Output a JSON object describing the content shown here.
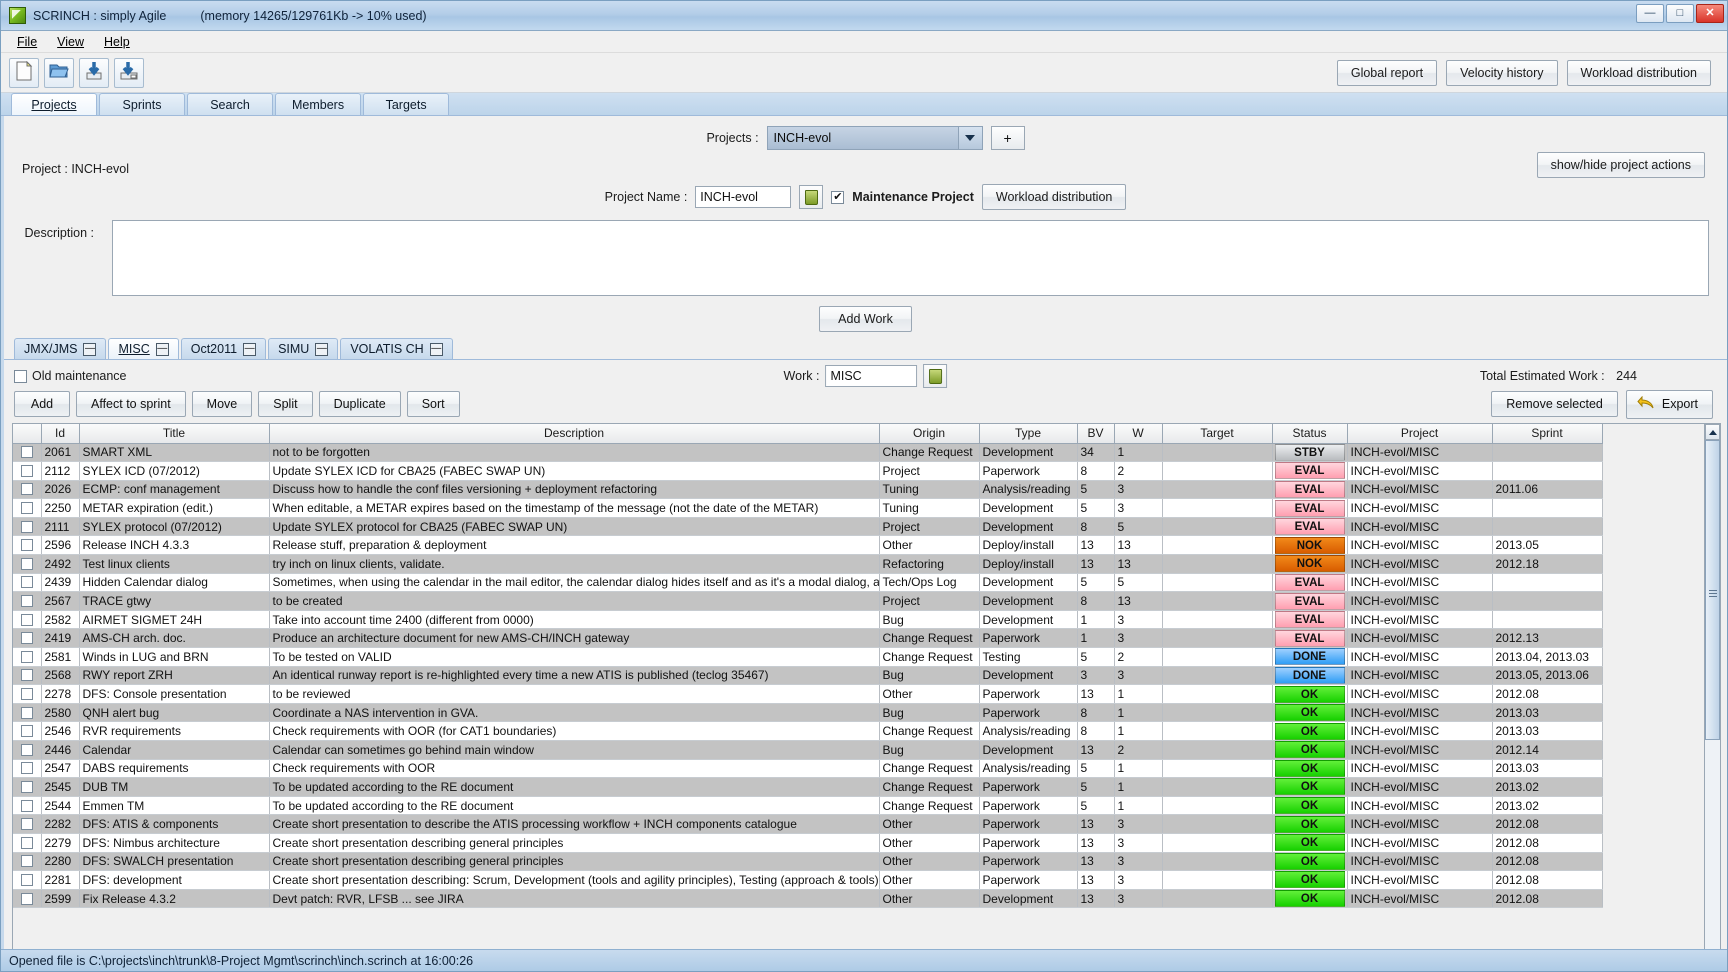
{
  "window": {
    "title": "SCRINCH : simply Agile",
    "memory": "(memory 14265/129761Kb -> 10% used)",
    "minimize": "—",
    "maximize": "□",
    "close": "✕"
  },
  "menubar": [
    {
      "label": "File",
      "mnemonic": "F"
    },
    {
      "label": "View",
      "mnemonic": "V"
    },
    {
      "label": "Help",
      "mnemonic": "H"
    }
  ],
  "toolbar": {
    "icons": [
      "new-file-icon",
      "open-folder-icon",
      "save-icon",
      "save-as-icon"
    ],
    "global_report": "Global report",
    "velocity_history": "Velocity history",
    "workload_distribution": "Workload distribution"
  },
  "main_tabs": [
    {
      "label": "Projects",
      "active": true
    },
    {
      "label": "Sprints",
      "active": false
    },
    {
      "label": "Search",
      "active": false
    },
    {
      "label": "Members",
      "active": false
    },
    {
      "label": "Targets",
      "active": false
    }
  ],
  "project_panel": {
    "projects_label": "Projects :",
    "projects_value": "INCH-evol",
    "add_button": "+",
    "project_line": "Project : INCH-evol",
    "show_hide_button": "show/hide project actions",
    "project_name_label": "Project Name :",
    "project_name_value": "INCH-evol",
    "maintenance_label": "Maintenance Project",
    "maintenance_checked": "✔",
    "workload_distribution_button": "Workload distribution",
    "description_label": "Description :",
    "description_value": "",
    "add_work_button": "Add Work"
  },
  "sub_tabs": [
    {
      "label": "JMX/JMS",
      "close": "—",
      "active": false
    },
    {
      "label": "MISC",
      "close": "—",
      "active": true
    },
    {
      "label": "Oct2011",
      "close": "—",
      "active": false
    },
    {
      "label": "SIMU",
      "close": "—",
      "active": false
    },
    {
      "label": "VOLATIS CH",
      "close": "—",
      "active": false
    }
  ],
  "work_bar": {
    "old_maintenance_label": "Old maintenance",
    "old_maintenance_checked": false,
    "work_label": "Work :",
    "work_value": "MISC",
    "total_estimated_label": "Total Estimated Work :",
    "total_estimated_value": "244"
  },
  "actions": {
    "add": "Add",
    "affect_to_sprint": "Affect to sprint",
    "move": "Move",
    "split": "Split",
    "duplicate": "Duplicate",
    "sort": "Sort",
    "remove_selected": "Remove selected",
    "export": "Export"
  },
  "table": {
    "columns": [
      "",
      "Id",
      "Title",
      "Description",
      "Origin",
      "Type",
      "BV",
      "W",
      "Target",
      "Status",
      "Project",
      "Sprint"
    ],
    "rows": [
      {
        "id": "2061",
        "title": "SMART XML",
        "description": "not to be forgotten",
        "origin": "Change Request",
        "type": "Development",
        "bv": "34",
        "w": "1",
        "target": "",
        "status": "STBY",
        "project": "INCH-evol/MISC",
        "sprint": ""
      },
      {
        "id": "2112",
        "title": "SYLEX ICD (07/2012)",
        "description": "Update SYLEX ICD for CBA25 (FABEC SWAP UN)",
        "origin": "Project",
        "type": "Paperwork",
        "bv": "8",
        "w": "2",
        "target": "",
        "status": "EVAL",
        "project": "INCH-evol/MISC",
        "sprint": ""
      },
      {
        "id": "2026",
        "title": "ECMP: conf management",
        "description": "Discuss how to handle the conf files versioning + deployment refactoring",
        "origin": "Tuning",
        "type": "Analysis/reading",
        "bv": "5",
        "w": "3",
        "target": "",
        "status": "EVAL",
        "project": "INCH-evol/MISC",
        "sprint": "2011.06"
      },
      {
        "id": "2250",
        "title": "METAR expiration (edit.)",
        "description": "When editable, a METAR expires based on the timestamp of the message (not the date of the METAR)",
        "origin": "Tuning",
        "type": "Development",
        "bv": "5",
        "w": "3",
        "target": "",
        "status": "EVAL",
        "project": "INCH-evol/MISC",
        "sprint": ""
      },
      {
        "id": "2111",
        "title": "SYLEX protocol (07/2012)",
        "description": "Update SYLEX protocol for CBA25 (FABEC SWAP UN)",
        "origin": "Project",
        "type": "Development",
        "bv": "8",
        "w": "5",
        "target": "",
        "status": "EVAL",
        "project": "INCH-evol/MISC",
        "sprint": ""
      },
      {
        "id": "2596",
        "title": "Release INCH 4.3.3",
        "description": "Release stuff, preparation & deployment",
        "origin": "Other",
        "type": "Deploy/install",
        "bv": "13",
        "w": "13",
        "target": "",
        "status": "NOK",
        "project": "INCH-evol/MISC",
        "sprint": "2013.05"
      },
      {
        "id": "2492",
        "title": "Test linux clients",
        "description": "try inch on linux clients, validate.",
        "origin": "Refactoring",
        "type": "Deploy/install",
        "bv": "13",
        "w": "13",
        "target": "",
        "status": "NOK",
        "project": "INCH-evol/MISC",
        "sprint": "2012.18"
      },
      {
        "id": "2439",
        "title": "Hidden Calendar dialog",
        "description": "Sometimes, when using the calendar in the mail editor, the calendar dialog hides itself and as it's a modal dialog, all inputs...",
        "origin": "Tech/Ops Log",
        "type": "Development",
        "bv": "5",
        "w": "5",
        "target": "",
        "status": "EVAL",
        "project": "INCH-evol/MISC",
        "sprint": ""
      },
      {
        "id": "2567",
        "title": "TRACE gtwy",
        "description": "to be created",
        "origin": "Project",
        "type": "Development",
        "bv": "8",
        "w": "13",
        "target": "",
        "status": "EVAL",
        "project": "INCH-evol/MISC",
        "sprint": ""
      },
      {
        "id": "2582",
        "title": "AIRMET SIGMET 24H",
        "description": "Take into account time 2400 (different from 0000)",
        "origin": "Bug",
        "type": "Development",
        "bv": "1",
        "w": "3",
        "target": "",
        "status": "EVAL",
        "project": "INCH-evol/MISC",
        "sprint": ""
      },
      {
        "id": "2419",
        "title": "AMS-CH arch. doc.",
        "description": "Produce an architecture document for new AMS-CH/INCH gateway",
        "origin": "Change Request",
        "type": "Paperwork",
        "bv": "1",
        "w": "3",
        "target": "",
        "status": "EVAL",
        "project": "INCH-evol/MISC",
        "sprint": "2012.13"
      },
      {
        "id": "2581",
        "title": "Winds in LUG and BRN",
        "description": "To be tested on VALID",
        "origin": "Change Request",
        "type": "Testing",
        "bv": "5",
        "w": "2",
        "target": "",
        "status": "DONE",
        "project": "INCH-evol/MISC",
        "sprint": "2013.04, 2013.03"
      },
      {
        "id": "2568",
        "title": "RWY report ZRH",
        "description": "An identical runway report is re-highlighted every time a new ATIS is published (teclog 35467)",
        "origin": "Bug",
        "type": "Development",
        "bv": "3",
        "w": "3",
        "target": "",
        "status": "DONE",
        "project": "INCH-evol/MISC",
        "sprint": "2013.05, 2013.06"
      },
      {
        "id": "2278",
        "title": "DFS: Console presentation",
        "description": "to be reviewed",
        "origin": "Other",
        "type": "Paperwork",
        "bv": "13",
        "w": "1",
        "target": "",
        "status": "OK",
        "project": "INCH-evol/MISC",
        "sprint": "2012.08"
      },
      {
        "id": "2580",
        "title": "QNH alert bug",
        "description": "Coordinate a NAS intervention in GVA.",
        "origin": "Bug",
        "type": "Paperwork",
        "bv": "8",
        "w": "1",
        "target": "",
        "status": "OK",
        "project": "INCH-evol/MISC",
        "sprint": "2013.03"
      },
      {
        "id": "2546",
        "title": "RVR requirements",
        "description": "Check requirements with OOR (for CAT1 boundaries)",
        "origin": "Change Request",
        "type": "Analysis/reading",
        "bv": "8",
        "w": "1",
        "target": "",
        "status": "OK",
        "project": "INCH-evol/MISC",
        "sprint": "2013.03"
      },
      {
        "id": "2446",
        "title": "Calendar",
        "description": "Calendar can sometimes go behind main window",
        "origin": "Bug",
        "type": "Development",
        "bv": "13",
        "w": "2",
        "target": "",
        "status": "OK",
        "project": "INCH-evol/MISC",
        "sprint": "2012.14"
      },
      {
        "id": "2547",
        "title": "DABS requirements",
        "description": "Check requirements with OOR",
        "origin": "Change Request",
        "type": "Analysis/reading",
        "bv": "5",
        "w": "1",
        "target": "",
        "status": "OK",
        "project": "INCH-evol/MISC",
        "sprint": "2013.03"
      },
      {
        "id": "2545",
        "title": "DUB TM",
        "description": "To be updated according to the RE document",
        "origin": "Change Request",
        "type": "Paperwork",
        "bv": "5",
        "w": "1",
        "target": "",
        "status": "OK",
        "project": "INCH-evol/MISC",
        "sprint": "2013.02"
      },
      {
        "id": "2544",
        "title": "Emmen TM",
        "description": "To be updated according to the RE document",
        "origin": "Change Request",
        "type": "Paperwork",
        "bv": "5",
        "w": "1",
        "target": "",
        "status": "OK",
        "project": "INCH-evol/MISC",
        "sprint": "2013.02"
      },
      {
        "id": "2282",
        "title": "DFS: ATIS & components",
        "description": "Create short presentation to describe the ATIS processing workflow + INCH components catalogue",
        "origin": "Other",
        "type": "Paperwork",
        "bv": "13",
        "w": "3",
        "target": "",
        "status": "OK",
        "project": "INCH-evol/MISC",
        "sprint": "2012.08"
      },
      {
        "id": "2279",
        "title": "DFS: Nimbus architecture",
        "description": "Create short presentation describing general principles",
        "origin": "Other",
        "type": "Paperwork",
        "bv": "13",
        "w": "3",
        "target": "",
        "status": "OK",
        "project": "INCH-evol/MISC",
        "sprint": "2012.08"
      },
      {
        "id": "2280",
        "title": "DFS: SWALCH presentation",
        "description": "Create short presentation describing general principles",
        "origin": "Other",
        "type": "Paperwork",
        "bv": "13",
        "w": "3",
        "target": "",
        "status": "OK",
        "project": "INCH-evol/MISC",
        "sprint": "2012.08"
      },
      {
        "id": "2281",
        "title": "DFS: development",
        "description": "Create short presentation describing: Scrum, Development (tools and agility principles), Testing (approach & tools), Deploy...",
        "origin": "Other",
        "type": "Paperwork",
        "bv": "13",
        "w": "3",
        "target": "",
        "status": "OK",
        "project": "INCH-evol/MISC",
        "sprint": "2012.08"
      },
      {
        "id": "2599",
        "title": "Fix Release 4.3.2",
        "description": "Devt patch: RVR, LFSB ... see JIRA",
        "origin": "Other",
        "type": "Development",
        "bv": "13",
        "w": "3",
        "target": "",
        "status": "OK",
        "project": "INCH-evol/MISC",
        "sprint": "2012.08"
      }
    ]
  },
  "statusbar": {
    "text": "Opened file is C:\\projects\\inch\\trunk\\8-Project Mgmt\\scrinch\\inch.scrinch at 16:00:26"
  },
  "colors": {
    "status_stby": "#c8cbce",
    "status_eval": "#ffadbd",
    "status_nok": "#e06a00",
    "status_done": "#49a8f7",
    "status_ok": "#24dc06"
  }
}
